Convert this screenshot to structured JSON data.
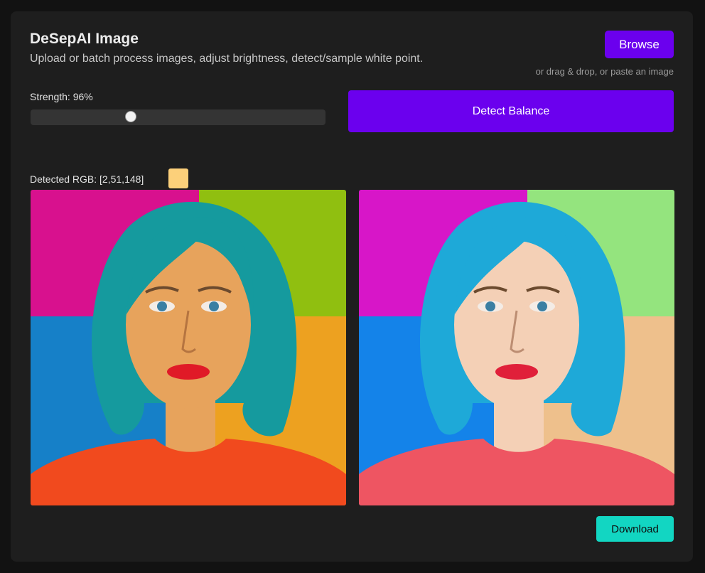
{
  "app": {
    "title": "DeSepAI Image",
    "subtitle": "Upload or batch process images, adjust brightness, detect/sample white point."
  },
  "upload": {
    "browse_label": "Browse",
    "hint": "or drag & drop, or paste an image"
  },
  "strength": {
    "label": "Strength: 96%",
    "value_percent": 96,
    "slider_position_fraction": 0.34
  },
  "detect": {
    "button_label": "Detect Balance"
  },
  "detected": {
    "label": "Detected RGB: [2,51,148]",
    "swatch_color": "#fcd07a"
  },
  "images": {
    "original": {
      "description_icon": "portrait-image",
      "colors": {
        "top_left_bg": "#d8118e",
        "top_right_bg": "#90bf10",
        "bottom_left_bg": "#1680c8",
        "bottom_right_bg": "#eda120",
        "hair": "#159a9e",
        "skin": "#e7a35c",
        "shirt": "#f14a1e",
        "lips": "#e01a27"
      }
    },
    "corrected": {
      "description_icon": "portrait-image",
      "colors": {
        "top_left_bg": "#d716c8",
        "top_right_bg": "#94e47e",
        "bottom_left_bg": "#1483e9",
        "bottom_right_bg": "#eec08c",
        "hair": "#1ea9d8",
        "skin": "#f4d0b6",
        "shirt": "#ee5562",
        "lips": "#e0203a"
      }
    }
  },
  "download": {
    "button_label": "Download"
  },
  "colors": {
    "accent": "#6b00ee",
    "download": "#12d6c2",
    "card_bg": "#1e1e1e",
    "page_bg": "#121212"
  }
}
